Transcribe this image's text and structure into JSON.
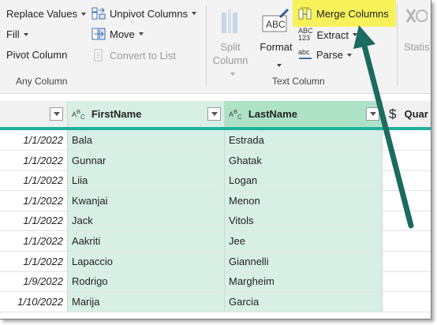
{
  "ribbon": {
    "replace_values": "Replace Values",
    "fill": "Fill",
    "pivot_column": "Pivot Column",
    "unpivot_columns": "Unpivot Columns",
    "move": "Move",
    "convert_to_list": "Convert to List",
    "any_column_label": "Any Column",
    "split_column_line1": "Split",
    "split_column_line2": "Column",
    "format": "Format",
    "merge_columns": "Merge Columns",
    "extract": "Extract",
    "parse": "Parse",
    "text_column_label": "Text Column",
    "statistics_partial": "Statis",
    "abc_123_glyph_top": "ABC",
    "abc_123_glyph_bottom": "123",
    "abc_parse_glyph": "abc",
    "format_glyph": "ABC"
  },
  "grid": {
    "columns": [
      {
        "name": "",
        "type_icon": ""
      },
      {
        "name": "FirstName",
        "type_icon_main": "A",
        "type_icon_sup": "B",
        "type_icon_sub": "C"
      },
      {
        "name": "LastName",
        "type_icon_main": "A",
        "type_icon_sup": "B",
        "type_icon_sub": "C"
      },
      {
        "name": "Quar",
        "type_icon": "$"
      }
    ],
    "rows": [
      {
        "date": "1/1/2022",
        "first": "Bala",
        "last": "Estrada"
      },
      {
        "date": "1/1/2022",
        "first": "Gunnar",
        "last": "Ghatak"
      },
      {
        "date": "1/1/2022",
        "first": "Liia",
        "last": "Logan"
      },
      {
        "date": "1/1/2022",
        "first": "Kwanjai",
        "last": "Menon"
      },
      {
        "date": "1/1/2022",
        "first": "Jack",
        "last": "Vitols"
      },
      {
        "date": "1/1/2022",
        "first": "Aakriti",
        "last": "Jee"
      },
      {
        "date": "1/1/2022",
        "first": "Lapaccio",
        "last": "Giannelli"
      },
      {
        "date": "1/9/2022",
        "first": "Rodrigo",
        "last": "Margheim"
      },
      {
        "date": "1/10/2022",
        "first": "Marija",
        "last": "Garcia"
      }
    ]
  },
  "colors": {
    "highlight": "#f7f25a",
    "arrow": "#1b6b5e",
    "selected_column": "#d7efe4",
    "header_underline": "#1fb29a"
  }
}
